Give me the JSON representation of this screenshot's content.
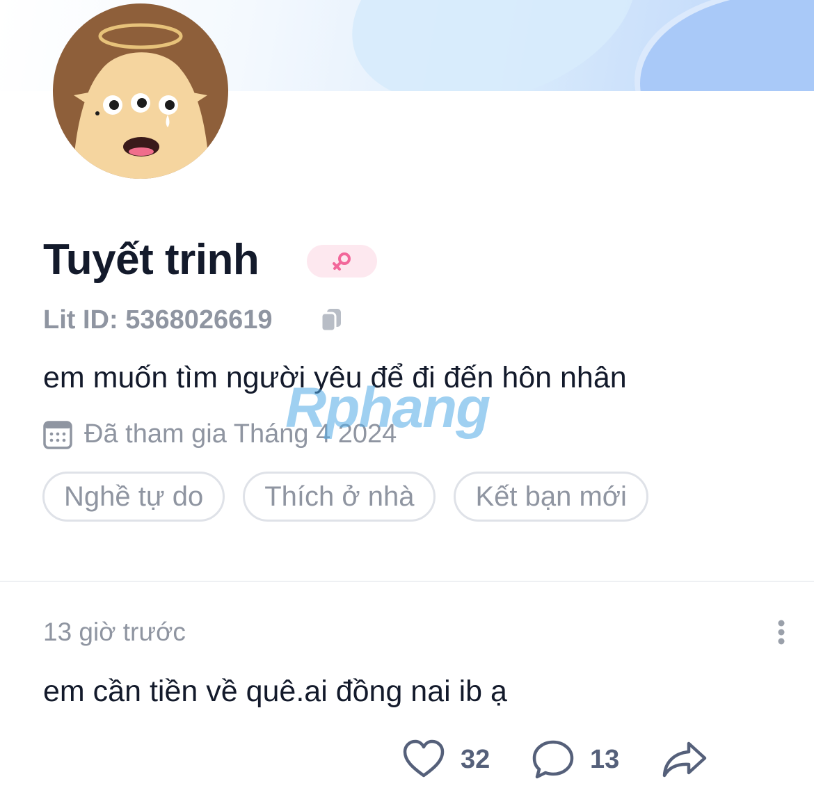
{
  "profile": {
    "name": "Tuyết trinh",
    "gender_symbol": "♀",
    "lit_id": "Lit ID: 5368026619",
    "bio": "em muốn tìm người yêu để đi đến hôn nhân",
    "joined": "Đã tham gia Tháng 4 2024",
    "tags": [
      "Nghề tự do",
      "Thích ở nhà",
      "Kết bạn mới"
    ]
  },
  "post": {
    "time": "13 giờ trước",
    "text": "em cần tiền về quê.ai đồng nai ib ạ",
    "likes": "32",
    "comments": "13"
  },
  "watermark": "Rphang",
  "colors": {
    "text_primary": "#131a2b",
    "text_secondary": "#8f95a1",
    "female_badge_bg": "#fde8ef",
    "female_badge_fg": "#f2679a",
    "avatar_bg": "#8e5f3a"
  },
  "icons": [
    "copy-icon",
    "calendar-icon",
    "more-vertical-icon",
    "heart-icon",
    "comment-icon",
    "share-icon",
    "female-icon"
  ]
}
